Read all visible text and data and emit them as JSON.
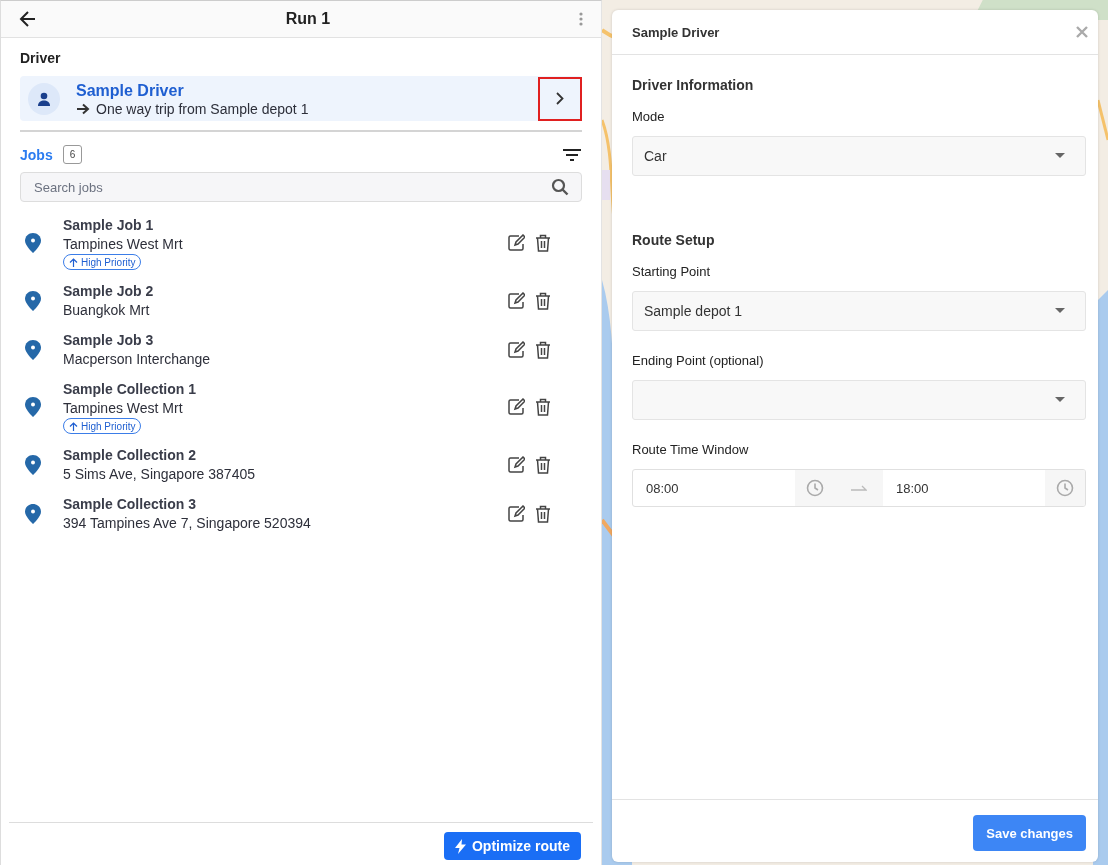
{
  "header": {
    "title": "Run 1"
  },
  "driver_section": {
    "label": "Driver",
    "driver": {
      "name": "Sample Driver",
      "trip": "One way trip from Sample depot 1",
      "chevron_highlighted": true
    }
  },
  "jobs": {
    "label": "Jobs",
    "count": "6",
    "search": {
      "placeholder": "Search jobs"
    },
    "items": [
      {
        "name": "Sample Job 1",
        "address": "Tampines West Mrt",
        "priority": "High Priority"
      },
      {
        "name": "Sample Job 2",
        "address": "Buangkok Mrt"
      },
      {
        "name": "Sample Job 3",
        "address": "Macperson Interchange"
      },
      {
        "name": "Sample Collection 1",
        "address": "Tampines West Mrt",
        "priority": "High Priority"
      },
      {
        "name": "Sample Collection 2",
        "address": "5 Sims Ave, Singapore 387405"
      },
      {
        "name": "Sample Collection 3",
        "address": "394 Tampines Ave 7, Singapore 520394"
      }
    ]
  },
  "footer": {
    "button": "Optimize route"
  },
  "dialog": {
    "title": "Sample Driver",
    "sections": [
      {
        "heading": "Driver Information",
        "fields": [
          {
            "kind": "select",
            "label": "Mode",
            "value": "Car"
          }
        ]
      },
      {
        "heading": "Route Setup",
        "fields": [
          {
            "kind": "select",
            "label": "Starting Point",
            "value": "Sample depot 1"
          },
          {
            "kind": "select",
            "label": "Ending Point (optional)"
          },
          {
            "kind": "time_range",
            "label": "Route Time Window",
            "start": "08:00",
            "end": "18:00"
          }
        ]
      }
    ],
    "save_button": "Save changes"
  }
}
